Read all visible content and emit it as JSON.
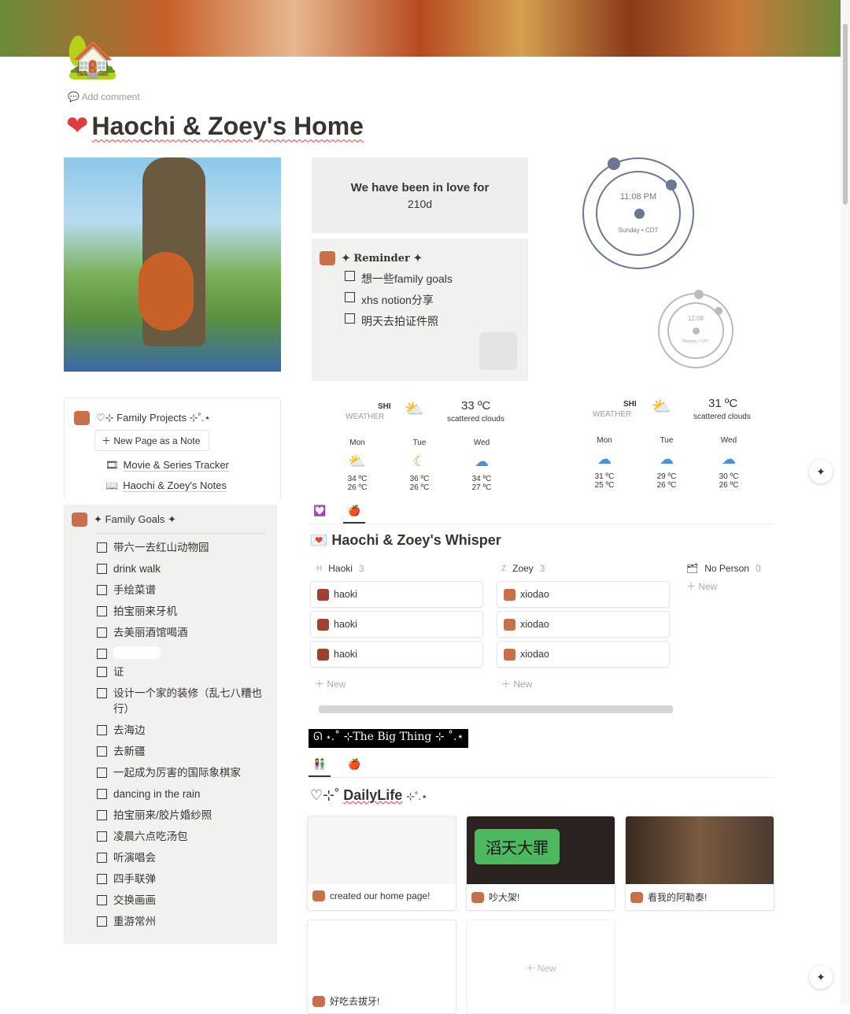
{
  "page": {
    "icon": "house-icon",
    "add_comment": "Add comment",
    "title_icon": "heart-icon",
    "title": "Haochi & Zoey's Home"
  },
  "love": {
    "heading": "We have been in love for",
    "value": "210d"
  },
  "reminder": {
    "title": "✦ Reminder ✦",
    "items": [
      {
        "text": "想一些family goals",
        "checked": false
      },
      {
        "text": "xhs notion分享",
        "checked": false
      },
      {
        "text": "明天去拍证件照",
        "checked": false
      }
    ]
  },
  "clocks": [
    {
      "time": "11:08 PM",
      "day": "Sunday • CDT"
    },
    {
      "time": "12:08",
      "day": "Monday • CDT"
    }
  ],
  "weather": [
    {
      "location": "SHI",
      "label": "WEATHER",
      "temp": "33 ºC",
      "desc": "scattered clouds",
      "days": [
        {
          "d": "Mon",
          "icon": "⛅",
          "hi": "34 ºC",
          "lo": "26 ºC"
        },
        {
          "d": "Tue",
          "icon": "🌙",
          "hi": "36 ºC",
          "lo": "26 ºC"
        },
        {
          "d": "Wed",
          "icon": "🌧",
          "hi": "34 ºC",
          "lo": "27 ºC"
        }
      ]
    },
    {
      "location": "SHI",
      "label": "WEATHER",
      "temp": "31 ºC",
      "desc": "scattered clouds",
      "days": [
        {
          "d": "Mon",
          "icon": "🌧",
          "hi": "31 ºC",
          "lo": "25 ºC"
        },
        {
          "d": "Tue",
          "icon": "🌧",
          "hi": "29 ºC",
          "lo": "26 ºC"
        },
        {
          "d": "Wed",
          "icon": "🌧",
          "hi": "30 ºC",
          "lo": "26 ºC"
        }
      ]
    }
  ],
  "family_projects": {
    "title": "♡⊹ Family Projects ⊹˚.⋆",
    "new_page": "New Page as a Note",
    "links": [
      {
        "icon": "🎞",
        "label": "Movie & Series Tracker"
      },
      {
        "icon": "📖",
        "label": "Haochi & Zoey's Notes"
      }
    ]
  },
  "family_goals": {
    "title": "✦ Family Goals ✦",
    "items": [
      "带六一去红山动物园",
      "drink walk",
      "手绘菜谱",
      "拍宝丽来牙机",
      "去美丽酒馆喝酒",
      "",
      "证",
      "设计一个家的装修（乱七八糟也行）",
      "去海边",
      "去新疆",
      "一起成为厉害的国际象棋家",
      "dancing in the rain",
      "拍宝丽来/胶片婚纱照",
      "凌晨六点吃汤包",
      "听演唱会",
      "四手联弹",
      "交换画画",
      "重游常州"
    ]
  },
  "whisper": {
    "tabs": [
      "💟",
      "🍎"
    ],
    "title": "Haochi & Zoey's Whisper",
    "columns": [
      {
        "initial": "H",
        "name": "Haoki",
        "count": "3",
        "cards": [
          "haoki",
          "haoki",
          "haoki"
        ]
      },
      {
        "initial": "Z",
        "name": "Zoey",
        "count": "3",
        "cards": [
          "xiodao",
          "xiodao",
          "xiodao"
        ]
      },
      {
        "initial": "",
        "name": "No Person",
        "count": "0",
        "cards": []
      }
    ],
    "new": "New"
  },
  "big_thing": "ᘏ ⋆.˚ ⊹The Big Thing ⊹ ˚.⋆",
  "daily": {
    "tabs": [
      "👫",
      "🍎"
    ],
    "title_prefix": "♡⊹˚",
    "title": "DailyLife",
    "title_suffix": "⊹˚.⋆",
    "cards": [
      {
        "caption": "created our home page!",
        "thumb_text": ""
      },
      {
        "caption": "吵大架!",
        "thumb_text": "滔天大罪"
      },
      {
        "caption": "看我的阿勒泰!",
        "thumb_text": ""
      },
      {
        "caption": "好吃去拔牙!",
        "thumb_text": ""
      }
    ],
    "new": "New"
  }
}
